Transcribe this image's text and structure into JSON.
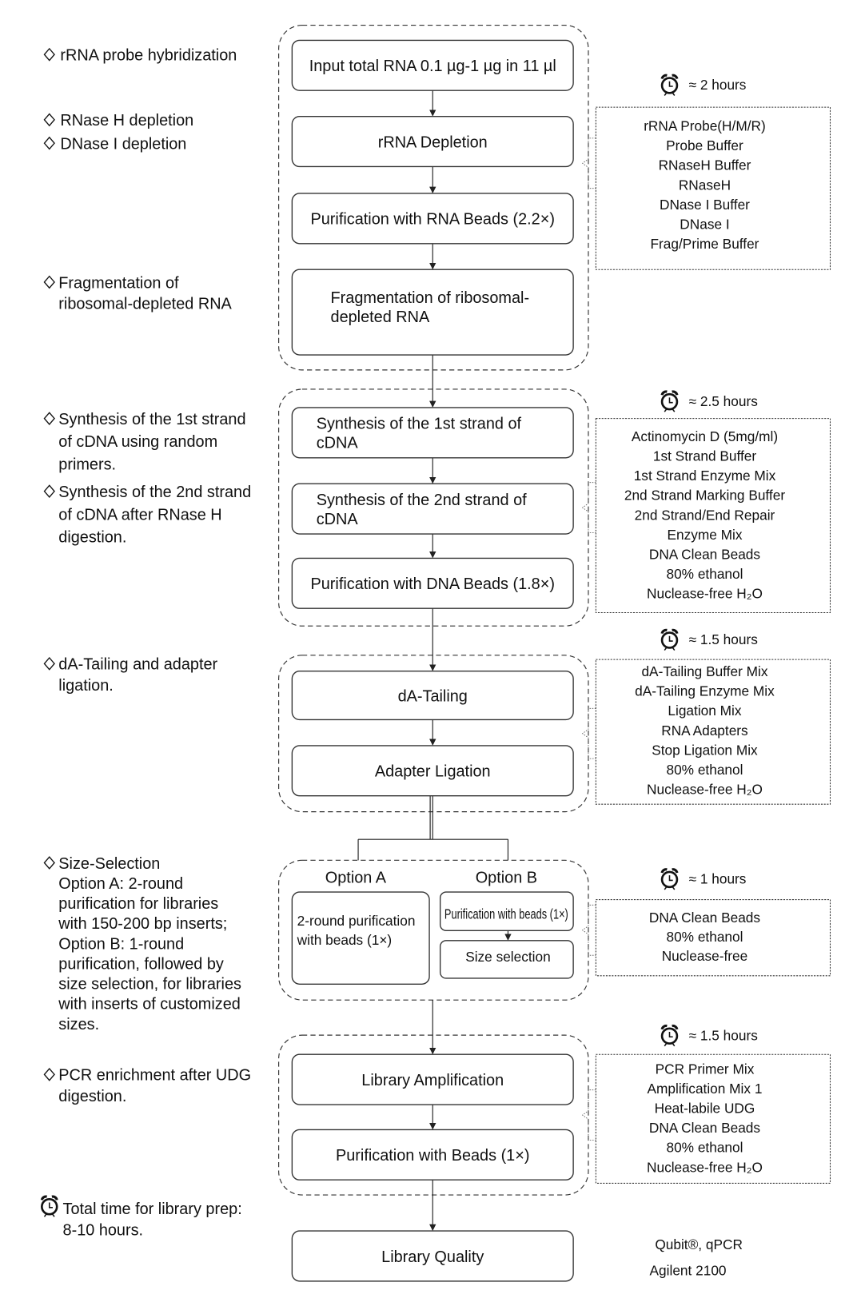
{
  "left_notes": [
    {
      "lines": [
        "rRNA probe hybridization"
      ],
      "marker": "diamond"
    },
    {
      "lines": [
        "RNase H depletion"
      ],
      "marker": "diamond"
    },
    {
      "lines": [
        "DNase I depletion"
      ],
      "marker": "diamond"
    },
    {
      "lines": [
        "Fragmentation of",
        "ribosomal-depleted RNA"
      ],
      "marker": "diamond"
    },
    {
      "lines": [
        "Synthesis of the 1st strand",
        "of cDNA using random",
        "primers."
      ],
      "marker": "diamond"
    },
    {
      "lines": [
        "Synthesis of the 2nd strand",
        "of cDNA after RNase H",
        "digestion."
      ],
      "marker": "diamond"
    },
    {
      "lines": [
        "dA-Tailing and adapter",
        "ligation."
      ],
      "marker": "diamond"
    },
    {
      "lines": [
        "Size-Selection",
        "Option A:  2-round",
        "purification for libraries",
        "with 150-200 bp inserts;",
        "Option B: 1-round",
        "purification, followed by",
        "size selection, for libraries",
        "with inserts of customized",
        "sizes."
      ],
      "marker": "diamond"
    },
    {
      "lines": [
        "PCR enrichment after UDG",
        "digestion."
      ],
      "marker": "diamond"
    },
    {
      "lines": [
        "Total time for library prep:",
        "8-10 hours."
      ],
      "marker": "alarm-clock"
    }
  ],
  "steps": [
    {
      "lines": [
        "Input total RNA 0.1 µg-1 µg in 11 µl"
      ]
    },
    {
      "lines": [
        "rRNA Depletion"
      ]
    },
    {
      "lines": [
        "Purification with RNA Beads (2.2×)"
      ]
    },
    {
      "lines": [
        "Fragmentation of ribosomal-",
        "depleted RNA"
      ]
    },
    {
      "lines": [
        "Synthesis of the 1st strand of",
        "cDNA"
      ]
    },
    {
      "lines": [
        "Synthesis of the 2nd strand of",
        "cDNA"
      ]
    },
    {
      "lines": [
        "Purification with DNA Beads (1.8×)"
      ]
    },
    {
      "lines": [
        "dA-Tailing"
      ]
    },
    {
      "lines": [
        "Adapter Ligation"
      ]
    },
    {
      "lines": [
        "Library Amplification"
      ]
    },
    {
      "lines": [
        "Purification with Beads (1×)"
      ]
    },
    {
      "lines": [
        "Library Quality"
      ]
    }
  ],
  "options": {
    "a_title": "Option A",
    "b_title": "Option B",
    "a_step": [
      "2-round purification",
      "with beads (1×)"
    ],
    "b_steps": [
      "Purification with beads (1×)",
      "Size selection"
    ]
  },
  "reagent_panels": [
    {
      "time": "≈  2 hours",
      "items": [
        "rRNA Probe(H/M/R)",
        "Probe Buffer",
        "RNaseH Buffer",
        "RNaseH",
        "DNase I Buffer",
        "DNase I",
        "Frag/Prime Buffer"
      ]
    },
    {
      "time": "≈  2.5 hours",
      "items": [
        "Actinomycin D (5mg/ml)",
        "1st Strand Buffer",
        "1st Strand Enzyme Mix",
        "2nd Strand Marking Buffer",
        "2nd Strand/End Repair",
        "Enzyme Mix",
        "DNA Clean Beads",
        "80% ethanol",
        "Nuclease-free H₂O"
      ]
    },
    {
      "time": "≈  1.5 hours",
      "items": [
        "dA-Tailing Buffer Mix",
        "dA-Tailing Enzyme Mix",
        "Ligation Mix",
        "RNA Adapters",
        "Stop Ligation Mix",
        "80% ethanol",
        "Nuclease-free H₂O"
      ]
    },
    {
      "time": "≈  1 hours",
      "items": [
        "DNA Clean Beads",
        "80% ethanol",
        "Nuclease-free"
      ]
    },
    {
      "time": "≈  1.5 hours",
      "items": [
        "PCR Primer Mix",
        "Amplification Mix 1",
        "Heat-labile UDG",
        "DNA Clean Beads",
        "80% ethanol",
        "Nuclease-free H₂O"
      ]
    }
  ],
  "quality_methods": [
    "Qubit®, qPCR",
    "Agilent 2100"
  ]
}
